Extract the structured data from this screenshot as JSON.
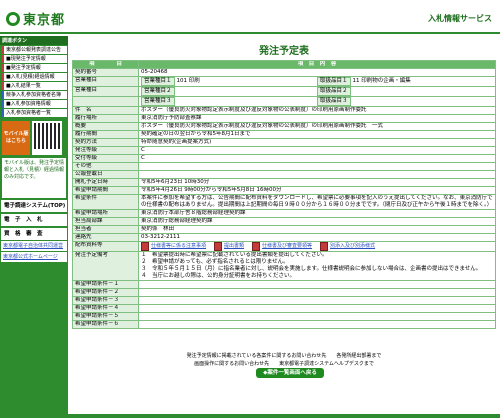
{
  "header": {
    "logo_text": "東京都",
    "service_title": "入札情報サービス"
  },
  "sidebar": {
    "menu_head": "調達ボタン",
    "items": [
      "東京都公報発表調達公告",
      "■現発注予定情報",
      "■発注予定情報",
      "■入札(見積)経過情報",
      "■入札結果一覧",
      "競争入札参加資格者名簿",
      "■入札参加資格情報",
      "入札参加資格者一覧"
    ],
    "mobile_label": "モバイル版はこちら",
    "mobile_note": "モバイル版は、発注予定情報と入札（見積）経過情報のみ対応です。",
    "links": [
      "電子調達システム(TOP)",
      "電　子　入　札",
      "資　格　審　査"
    ],
    "small_links": [
      "東京都電子自治体共同運営",
      "東京都公式ホームページ"
    ]
  },
  "main": {
    "title": "発注予定表",
    "col_item": "項　　　　目",
    "col_content": "項　目　内　容",
    "rows": [
      {
        "label": "契約番号",
        "value": "05-20468"
      },
      {
        "label": "営業種目",
        "sub1": "営業種目１",
        "val1": "101 印刷",
        "sub2": "取扱品目１",
        "val2": "11 印刷物の企画・編集"
      },
      {
        "label": "営業種目",
        "sub1": "営業種目２",
        "val1": "",
        "sub2": "取扱品目２",
        "val2": ""
      },
      {
        "label": "",
        "sub1": "営業種目３",
        "val1": "",
        "sub2": "取扱品目３",
        "val2": ""
      },
      {
        "label": "件　名",
        "value": "ポスター（優良防火対象物認定表示制度及び違反対象物の公表制度）の印刷用原画制作委託"
      },
      {
        "label": "履行場所",
        "value": "東京消防庁予防部査察課"
      },
      {
        "label": "概要",
        "value": "ポスター（優良防火対象物認定表示制度及び違反対象物の公表制度）の印刷用原画制作委託　一式"
      },
      {
        "label": "履行期間",
        "value": "契約確定の日の翌日から令和5年8月1日まで"
      },
      {
        "label": "契約方法",
        "value": "特命随意契約(企画提案方式)"
      },
      {
        "label": "発注等級",
        "value": "C"
      },
      {
        "label": "受付等級",
        "value": "C"
      },
      {
        "label": "その他",
        "value": ""
      },
      {
        "label": "公報登載日",
        "value": ""
      },
      {
        "label": "開札予定日時",
        "value": "令和5年6月23日 10時30分"
      },
      {
        "label": "希望申請期間",
        "value": "令和5年4月26日 9時00分から令和5年5月8日 16時00分"
      },
      {
        "label": "希望条件",
        "value": "本案件に参加を希望する方は、公告期間に配布資料をダウンロードし、希望票に必要事項を記入のうえ提出してください。なお、東京消防庁での仕様書の配布はありません。提出期間は上記期間の毎日９時００分から１６時００分までです。（閉庁日及び正午から午後１時までを除く。）"
      },
      {
        "label": "希望申請場所",
        "value": "東京消防庁本部庁舎８階総務部経理契約課"
      },
      {
        "label": "担当局部課",
        "value": "東京消防庁総務部経理契約課"
      },
      {
        "label": "担当者",
        "value": "契約係　林田"
      },
      {
        "label": "連絡先",
        "value": "03-3212-2111"
      }
    ],
    "docs_label": "配布資料等",
    "docs": [
      "仕様書等に係る注意事項",
      "提出書類",
      "仕様書及び審査要領等",
      "別添入及び別添様式"
    ],
    "remarks_label": "発注予定備考",
    "remarks": [
      "１　希望票提出時に希望票に記載されている提出書類を提出してください。",
      "２　希望申請があっても、必ず指名されるとは限りません。",
      "３　令和５年５月１５日（月）に指名業者に対し、説明会を実施します。仕様書説明会に参加しない場合は、企画書の提出はできません。",
      "４　当庁にお越しの際は、公的身分証明書をお持ちください。"
    ],
    "empty_rows": [
      "希望申請条件－１",
      "希望申請条件－２",
      "希望申請条件－３",
      "希望申請条件－４",
      "希望申請条件－５",
      "希望申請条件－６"
    ],
    "back_button": "◆案件一覧画面へ戻る",
    "footer_line1": "発注予定情報に掲載されている各案件に関するお問い合わせ先　　各発所経出部署まで",
    "footer_line2": "画面操作に関するお問い合わせ先　　東京都電子調達システムヘルプデスクまで"
  }
}
